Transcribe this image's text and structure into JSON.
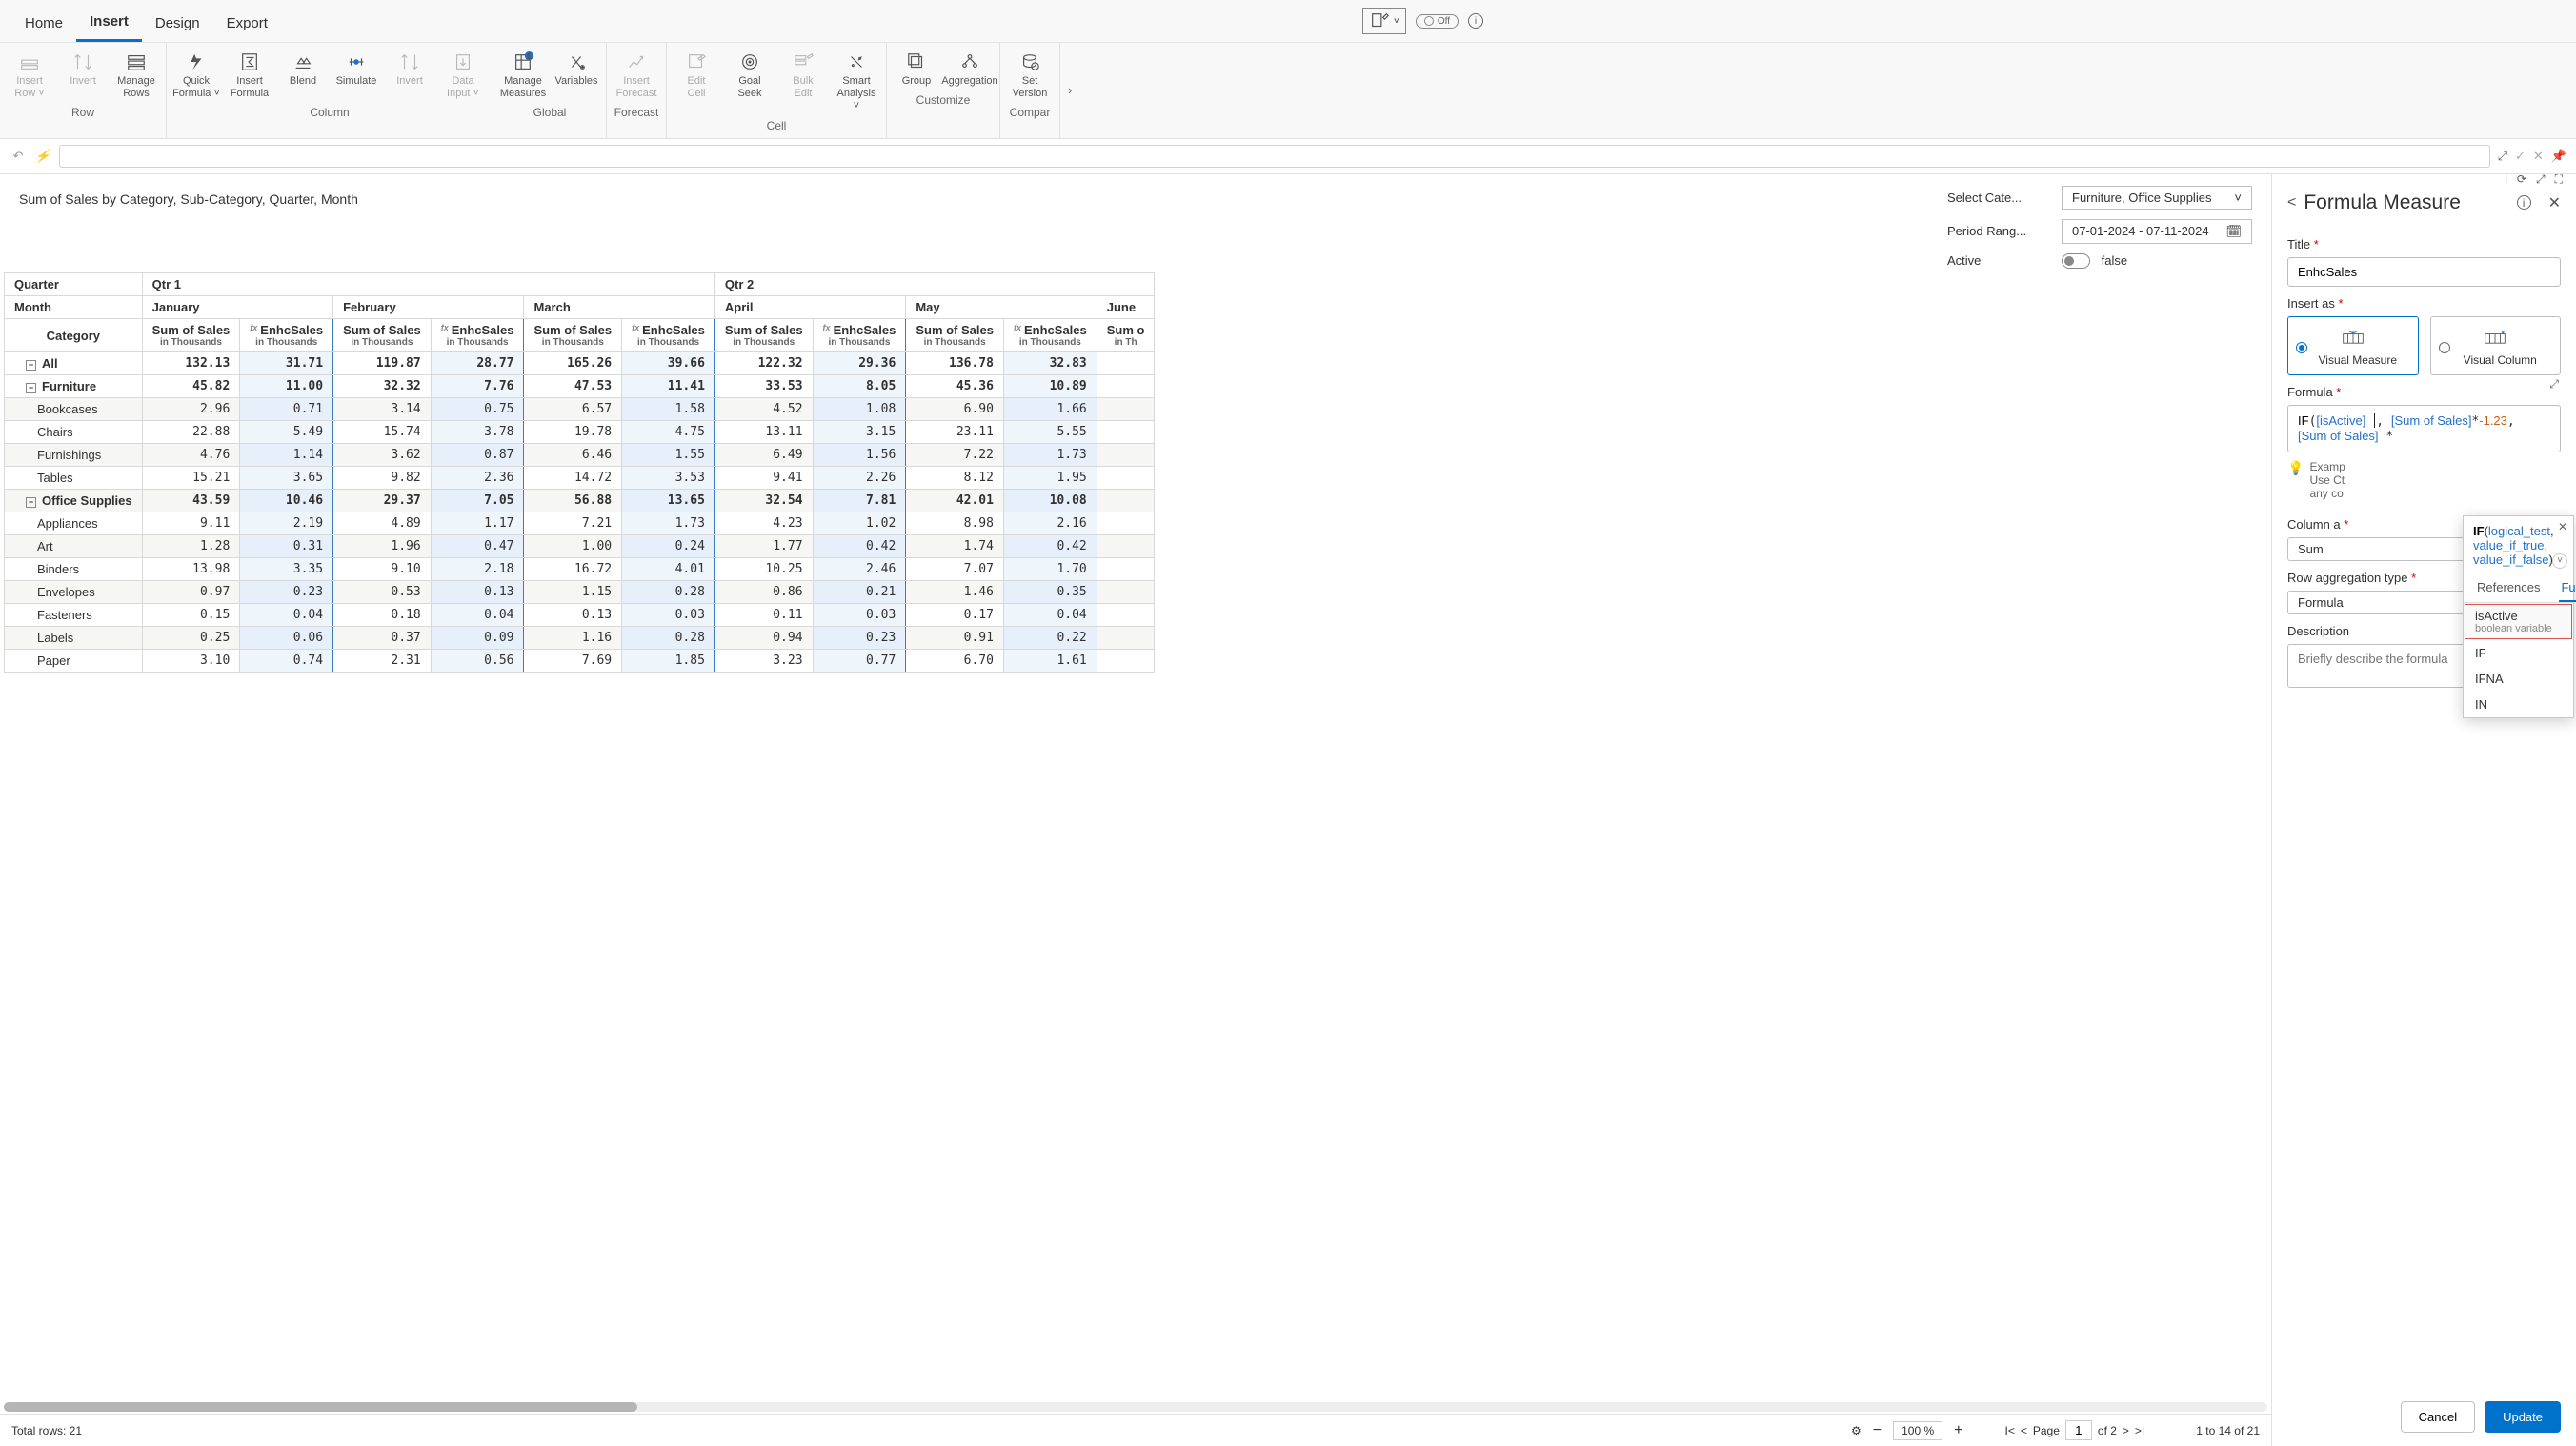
{
  "tabs": [
    "Home",
    "Insert",
    "Design",
    "Export"
  ],
  "active_tab": "Insert",
  "ribbon": {
    "groups": [
      {
        "label": "Row",
        "items": [
          {
            "l1": "Insert",
            "l2": "Row ˅",
            "disabled": true,
            "icon": "insert-row"
          },
          {
            "l1": "Invert",
            "l2": "",
            "disabled": true,
            "icon": "invert"
          },
          {
            "l1": "Manage",
            "l2": "Rows",
            "icon": "manage-rows"
          }
        ]
      },
      {
        "label": "Column",
        "items": [
          {
            "l1": "Quick",
            "l2": "Formula ˅",
            "icon": "quick-formula"
          },
          {
            "l1": "Insert",
            "l2": "Formula",
            "icon": "insert-formula"
          },
          {
            "l1": "Blend",
            "l2": "",
            "icon": "blend"
          },
          {
            "l1": "Simulate",
            "l2": "",
            "icon": "simulate"
          },
          {
            "l1": "Invert",
            "l2": "",
            "disabled": true,
            "icon": "invert"
          },
          {
            "l1": "Data",
            "l2": "Input ˅",
            "disabled": true,
            "icon": "data-input"
          }
        ]
      },
      {
        "label": "Global",
        "items": [
          {
            "l1": "Manage",
            "l2": "Measures",
            "icon": "manage-measures",
            "badge": "1"
          },
          {
            "l1": "Variables",
            "l2": "",
            "icon": "variables"
          }
        ]
      },
      {
        "label": "Forecast",
        "items": [
          {
            "l1": "Insert",
            "l2": "Forecast",
            "disabled": true,
            "icon": "forecast"
          }
        ]
      },
      {
        "label": "Cell",
        "items": [
          {
            "l1": "Edit",
            "l2": "Cell",
            "disabled": true,
            "icon": "edit-cell"
          },
          {
            "l1": "Goal",
            "l2": "Seek",
            "icon": "goal-seek"
          },
          {
            "l1": "Bulk",
            "l2": "Edit",
            "disabled": true,
            "icon": "bulk-edit"
          },
          {
            "l1": "Smart",
            "l2": "Analysis ˅",
            "icon": "smart"
          }
        ]
      },
      {
        "label": "Customize",
        "items": [
          {
            "l1": "Group",
            "l2": "",
            "icon": "group"
          },
          {
            "l1": "Aggregation",
            "l2": "",
            "icon": "aggregation"
          }
        ]
      },
      {
        "label": "Compar",
        "items": [
          {
            "l1": "Set",
            "l2": "Version",
            "icon": "set-version"
          }
        ]
      }
    ]
  },
  "edit_toggle": "Off",
  "filters": {
    "title": "Sum of Sales by Category, Sub-Category, Quarter, Month",
    "categoryLabel": "Select Cate...",
    "categoryValue": "Furniture, Office Supplies",
    "rangeLabel": "Period Rang...",
    "rangeValue": "07-01-2024 - 07-11-2024",
    "activeLabel": "Active",
    "activeValue": "false"
  },
  "header": {
    "quarter": "Quarter",
    "month": "Month",
    "category": "Category",
    "quarters": [
      "Qtr 1",
      "Qtr 2"
    ],
    "months": [
      "January",
      "February",
      "March",
      "April",
      "May",
      "June"
    ],
    "m1": "Sum of Sales",
    "m1s": "in Thousands",
    "m2": "EnhcSales",
    "m2s": "in Thousands"
  },
  "rows": [
    {
      "type": "all",
      "label": "All",
      "vals": [
        "132.13",
        "31.71",
        "119.87",
        "28.77",
        "165.26",
        "39.66",
        "122.32",
        "29.36",
        "136.78",
        "32.83",
        ""
      ]
    },
    {
      "type": "grp",
      "label": "Furniture",
      "vals": [
        "45.82",
        "11.00",
        "32.32",
        "7.76",
        "47.53",
        "11.41",
        "33.53",
        "8.05",
        "45.36",
        "10.89",
        ""
      ]
    },
    {
      "type": "row",
      "label": "Bookcases",
      "vals": [
        "2.96",
        "0.71",
        "3.14",
        "0.75",
        "6.57",
        "1.58",
        "4.52",
        "1.08",
        "6.90",
        "1.66",
        ""
      ]
    },
    {
      "type": "row",
      "label": "Chairs",
      "vals": [
        "22.88",
        "5.49",
        "15.74",
        "3.78",
        "19.78",
        "4.75",
        "13.11",
        "3.15",
        "23.11",
        "5.55",
        ""
      ]
    },
    {
      "type": "row",
      "label": "Furnishings",
      "vals": [
        "4.76",
        "1.14",
        "3.62",
        "0.87",
        "6.46",
        "1.55",
        "6.49",
        "1.56",
        "7.22",
        "1.73",
        ""
      ]
    },
    {
      "type": "row",
      "label": "Tables",
      "vals": [
        "15.21",
        "3.65",
        "9.82",
        "2.36",
        "14.72",
        "3.53",
        "9.41",
        "2.26",
        "8.12",
        "1.95",
        ""
      ]
    },
    {
      "type": "grp",
      "label": "Office Supplies",
      "vals": [
        "43.59",
        "10.46",
        "29.37",
        "7.05",
        "56.88",
        "13.65",
        "32.54",
        "7.81",
        "42.01",
        "10.08",
        ""
      ]
    },
    {
      "type": "row",
      "label": "Appliances",
      "vals": [
        "9.11",
        "2.19",
        "4.89",
        "1.17",
        "7.21",
        "1.73",
        "4.23",
        "1.02",
        "8.98",
        "2.16",
        ""
      ]
    },
    {
      "type": "row",
      "label": "Art",
      "vals": [
        "1.28",
        "0.31",
        "1.96",
        "0.47",
        "1.00",
        "0.24",
        "1.77",
        "0.42",
        "1.74",
        "0.42",
        ""
      ]
    },
    {
      "type": "row",
      "label": "Binders",
      "vals": [
        "13.98",
        "3.35",
        "9.10",
        "2.18",
        "16.72",
        "4.01",
        "10.25",
        "2.46",
        "7.07",
        "1.70",
        ""
      ]
    },
    {
      "type": "row",
      "label": "Envelopes",
      "vals": [
        "0.97",
        "0.23",
        "0.53",
        "0.13",
        "1.15",
        "0.28",
        "0.86",
        "0.21",
        "1.46",
        "0.35",
        ""
      ]
    },
    {
      "type": "row",
      "label": "Fasteners",
      "vals": [
        "0.15",
        "0.04",
        "0.18",
        "0.04",
        "0.13",
        "0.03",
        "0.11",
        "0.03",
        "0.17",
        "0.04",
        ""
      ]
    },
    {
      "type": "row",
      "label": "Labels",
      "vals": [
        "0.25",
        "0.06",
        "0.37",
        "0.09",
        "1.16",
        "0.28",
        "0.94",
        "0.23",
        "0.91",
        "0.22",
        ""
      ]
    },
    {
      "type": "row",
      "label": "Paper",
      "vals": [
        "3.10",
        "0.74",
        "2.31",
        "0.56",
        "7.69",
        "1.85",
        "3.23",
        "0.77",
        "6.70",
        "1.61",
        ""
      ]
    }
  ],
  "footer": {
    "totalrows": "Total rows: 21",
    "zoom": "100 %",
    "page": "1",
    "ofpages": "of 2",
    "pageLabel": "Page",
    "range": "1  to  14  of  21"
  },
  "panel": {
    "title": "Formula Measure",
    "titleLabel": "Title",
    "titleVal": "EnhcSales",
    "insertAs": "Insert as",
    "visualMeasure": "Visual Measure",
    "visualColumn": "Visual Column",
    "formulaLabel": "Formula",
    "colAgg": "Column a",
    "colAggVal": "Sum",
    "rowAgg": "Row aggregation type",
    "rowAggVal": "Formula",
    "desc": "Description",
    "descPh": "Briefly describe the formula",
    "hint1": "Examp",
    "hint2": "Use Ct",
    "hint3": "any co",
    "cancel": "Cancel",
    "update": "Update",
    "formula": {
      "fn": "IF",
      "ref1": "[isActive]",
      "ref2": "[Sum of Sales]",
      "num": "-1.23",
      "ref3": "[Sum of Sales]"
    }
  },
  "autocomplete": {
    "sigFn": "IF",
    "sig1": "logical_test",
    "sig2": "value_if_true",
    "sig3": "value_if_false",
    "tabRefs": "References",
    "tabFns": "Functions",
    "items": [
      {
        "label": "isActive",
        "sub": "boolean variable",
        "sel": true
      },
      {
        "label": "IF"
      },
      {
        "label": "IFNA"
      },
      {
        "label": "IN"
      }
    ]
  }
}
